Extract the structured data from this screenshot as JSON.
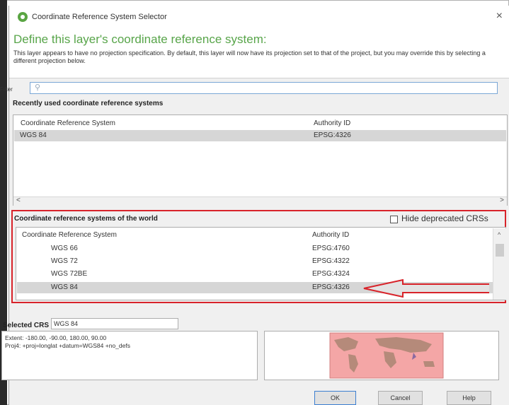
{
  "window": {
    "title": "Coordinate Reference System Selector",
    "close_label": "×"
  },
  "header": {
    "heading": "Define this layer's coordinate reference system:",
    "description": "This layer appears to have no projection specification. By default, this layer will now have its projection set to that of the project, but you may override this by selecting a different projection below."
  },
  "filter": {
    "label": "Filter",
    "value": "",
    "icon": "search-icon"
  },
  "recent": {
    "title": "Recently used coordinate reference systems",
    "columns": [
      "Coordinate Reference System",
      "Authority ID"
    ],
    "rows": [
      {
        "name": "WGS 84",
        "authid": "EPSG:4326",
        "selected": true
      }
    ],
    "scroll_left": "<",
    "scroll_right": ">"
  },
  "world": {
    "title": "Coordinate reference systems of the world",
    "hide_deprecated_label": "Hide deprecated CRSs",
    "hide_deprecated_checked": false,
    "columns": [
      "Coordinate Reference System",
      "Authority ID"
    ],
    "rows": [
      {
        "name": "WGS 66",
        "authid": "EPSG:4760",
        "selected": false
      },
      {
        "name": "WGS 72",
        "authid": "EPSG:4322",
        "selected": false
      },
      {
        "name": "WGS 72BE",
        "authid": "EPSG:4324",
        "selected": false
      },
      {
        "name": "WGS 84",
        "authid": "EPSG:4326",
        "selected": true
      }
    ],
    "scroll_up": "^"
  },
  "selected": {
    "label": "Selected CRS",
    "value": "WGS 84",
    "extent": "Extent: -180.00, -90.00, 180.00, 90.00",
    "proj4": "Proj4: +proj=longlat +datum=WGS84 +no_defs"
  },
  "buttons": {
    "ok": "OK",
    "cancel": "Cancel",
    "help": "Help"
  },
  "colors": {
    "heading": "#58a54a",
    "highlight_box": "#d8232a",
    "selection": "#d6d6d6",
    "map_extent": "#f4a6a6"
  }
}
